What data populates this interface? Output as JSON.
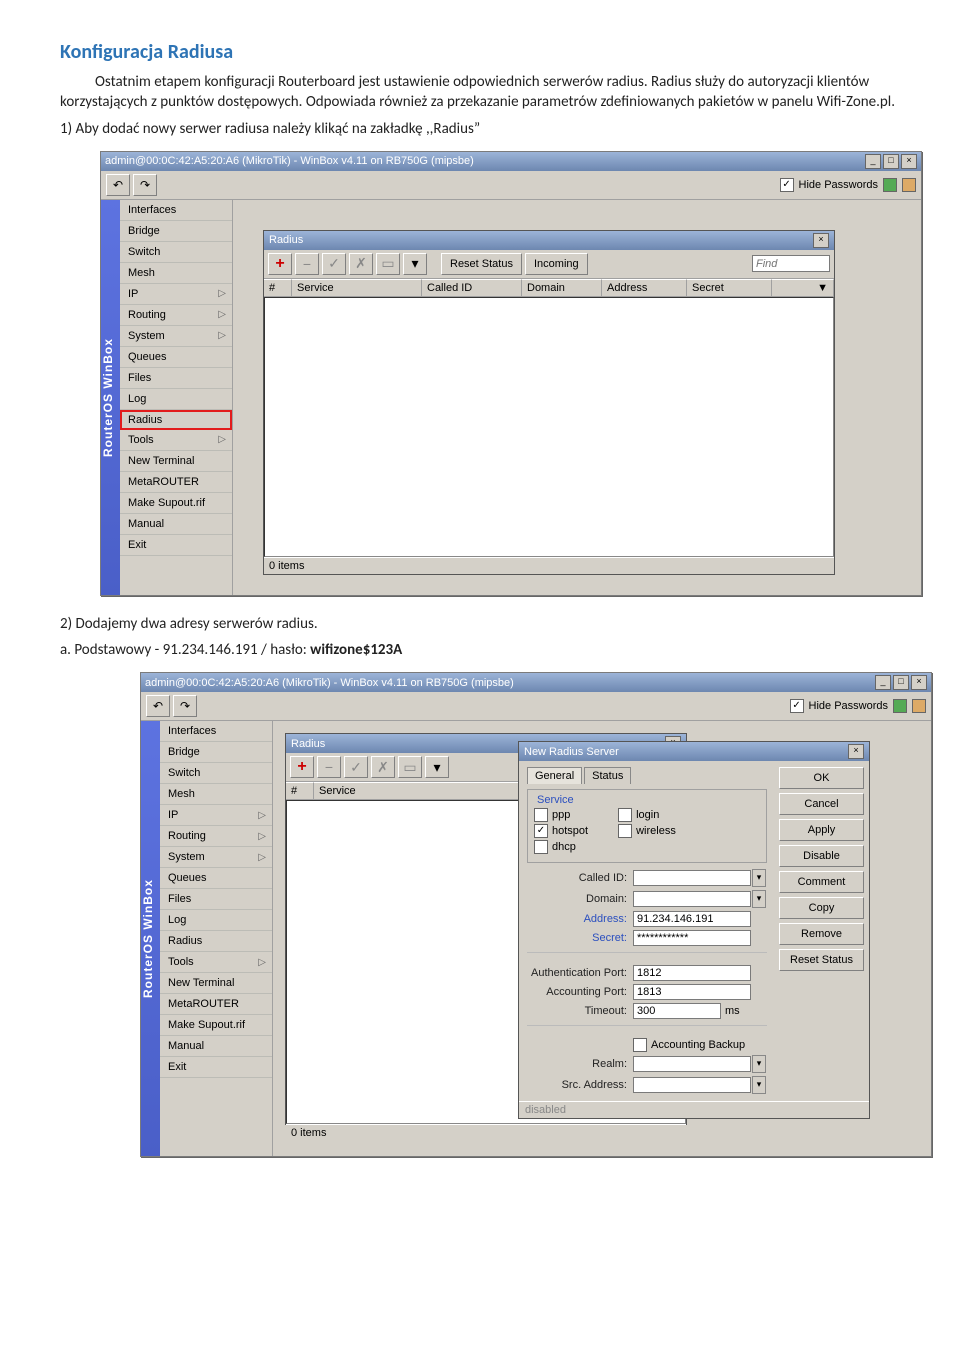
{
  "section_title": "Konfiguracja Radiusa",
  "para1": "Ostatnim etapem konfiguracji Routerboard jest ustawienie odpowiednich serwerów radius. Radius służy do autoryzacji klientów korzystających z punktów dostępowych. Odpowiada również za przekazanie parametrów zdefiniowanych pakietów w panelu Wifi-Zone.pl.",
  "step1": "1)   Aby dodać nowy serwer radiusa należy klikąć na zakładkę ,,Radius”",
  "step2": "2)   Dodajemy dwa adresy serwerów radius.",
  "step2a_prefix": "a.    Podstawowy - 91.234.146.191 / hasło: ",
  "step2a_bold": "wifizone$123A",
  "winbox": {
    "title": "admin@00:0C:42:A5:20:A6 (MikroTik) - WinBox v4.11 on RB750G (mipsbe)",
    "hide_passwords": "Hide Passwords",
    "side_label": "RouterOS WinBox",
    "menu": [
      "Interfaces",
      "Bridge",
      "Switch",
      "Mesh",
      "IP",
      "Routing",
      "System",
      "Queues",
      "Files",
      "Log",
      "Radius",
      "Tools",
      "New Terminal",
      "MetaROUTER",
      "Make Supout.rif",
      "Manual",
      "Exit"
    ],
    "submenu_items": [
      "IP",
      "Routing",
      "System",
      "Tools"
    ],
    "radius_win": {
      "title": "Radius",
      "reset": "Reset Status",
      "incoming": "Incoming",
      "find": "Find",
      "cols": [
        "#",
        "Service",
        "Called ID",
        "Domain",
        "Address",
        "Secret"
      ],
      "items": "0 items"
    }
  },
  "winbox2": {
    "title": "admin@00:0C:42:A5:20:A6 (MikroTik) - WinBox v4.11 on RB750G (mipsbe)",
    "radius_cols": [
      "#",
      "Service"
    ],
    "radius_items": "0 items",
    "dialog": {
      "title": "New Radius Server",
      "tabs": [
        "General",
        "Status"
      ],
      "service_legend": "Service",
      "chk": {
        "ppp": "ppp",
        "login": "login",
        "hotspot": "hotspot",
        "wireless": "wireless",
        "dhcp": "dhcp"
      },
      "labels": {
        "called_id": "Called ID:",
        "domain": "Domain:",
        "address": "Address:",
        "secret": "Secret:",
        "auth_port": "Authentication Port:",
        "acct_port": "Accounting Port:",
        "timeout": "Timeout:",
        "ms": "ms",
        "acct_backup": "Accounting Backup",
        "realm": "Realm:",
        "src": "Src. Address:"
      },
      "values": {
        "address": "91.234.146.191",
        "secret": "************",
        "auth_port": "1812",
        "acct_port": "1813",
        "timeout": "300"
      },
      "side": [
        "OK",
        "Cancel",
        "Apply",
        "Disable",
        "Comment",
        "Copy",
        "Remove",
        "Reset Status"
      ],
      "status": "disabled"
    }
  }
}
